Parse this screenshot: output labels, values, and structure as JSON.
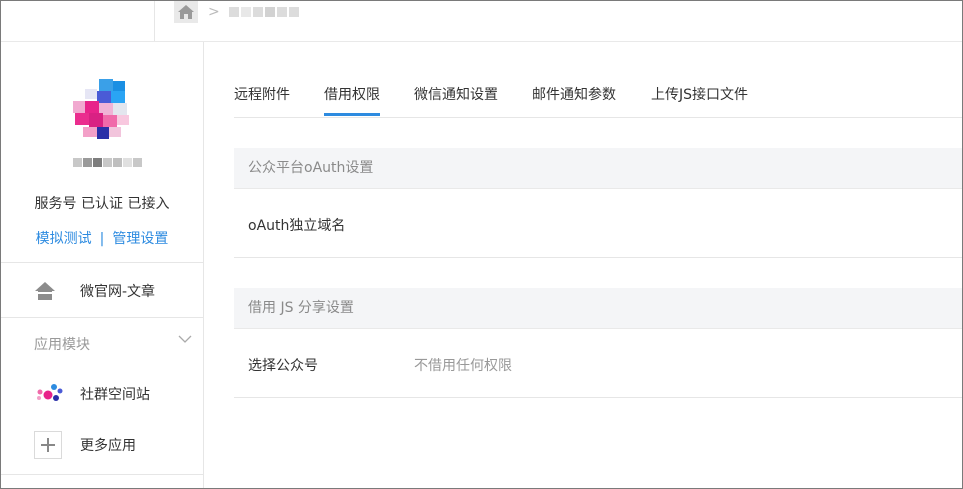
{
  "breadcrumb": {
    "separator": ">"
  },
  "sidebar": {
    "account_status": "服务号 已认证 已接入",
    "links": {
      "simulate": "模拟测试",
      "divider": "|",
      "manage": "管理设置"
    },
    "site_item": {
      "label": "微官网-文章",
      "icon": "home-icon"
    },
    "group": {
      "title": "应用模块",
      "icon": "chevron-down-icon"
    },
    "modules": [
      {
        "label": "社群空间站",
        "icon": "community-app-icon"
      },
      {
        "label": "更多应用",
        "icon": "plus-icon"
      }
    ]
  },
  "tabs": [
    {
      "label": "远程附件",
      "active": false
    },
    {
      "label": "借用权限",
      "active": true
    },
    {
      "label": "微信通知设置",
      "active": false
    },
    {
      "label": "邮件通知参数",
      "active": false
    },
    {
      "label": "上传JS接口文件",
      "active": false
    }
  ],
  "sections": [
    {
      "title": "公众平台oAuth设置",
      "rows": [
        {
          "label": "oAuth独立域名",
          "value": ""
        }
      ]
    },
    {
      "title": "借用 JS 分享设置",
      "rows": [
        {
          "label": "选择公众号",
          "value": "不借用任何权限"
        }
      ]
    }
  ],
  "colors": {
    "accent": "#2d8be0",
    "section_bg": "#f4f5f7",
    "border": "#e6e6e6"
  }
}
